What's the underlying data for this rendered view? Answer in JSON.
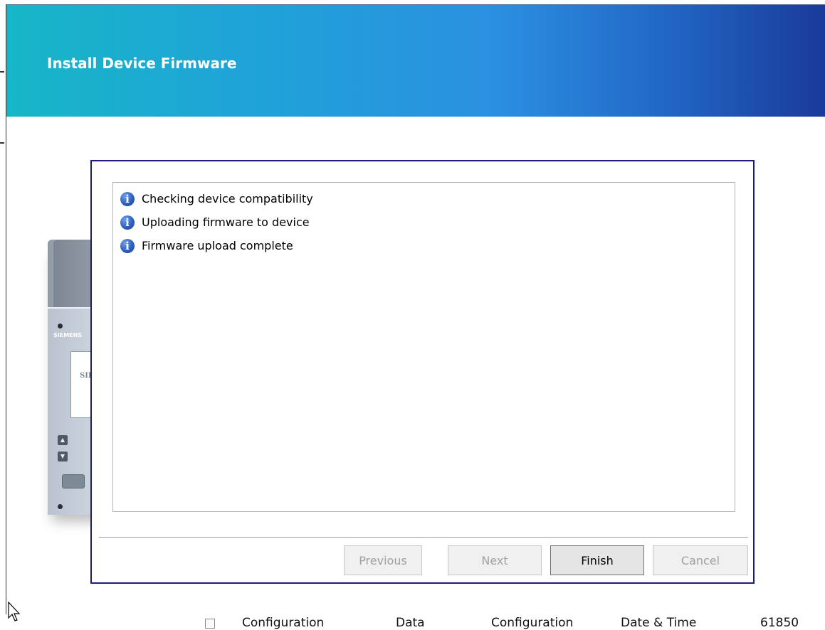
{
  "window": {
    "title": "Install Device Firmware"
  },
  "device": {
    "brand": "SIEMENS",
    "screen_text": "SIEM"
  },
  "log": {
    "items": [
      {
        "icon": "info-icon",
        "text": "Checking device compatibility"
      },
      {
        "icon": "info-icon",
        "text": "Uploading firmware to device"
      },
      {
        "icon": "info-icon",
        "text": "Firmware upload complete"
      }
    ]
  },
  "buttons": {
    "previous": "Previous",
    "next": "Next",
    "finish": "Finish",
    "cancel": "Cancel"
  },
  "background_table": {
    "cells": [
      "Configuration",
      "Data",
      "Configuration",
      "Date & Time",
      "61850"
    ]
  }
}
